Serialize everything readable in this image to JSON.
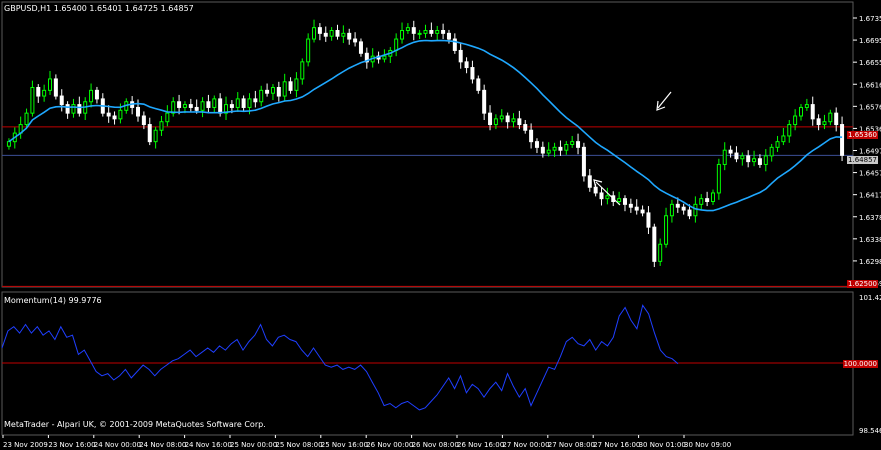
{
  "header": {
    "symbol_line": "GBPUSD,H1  1.65400 1.65401 1.64725 1.64857",
    "indicator_line": "Momentum(14) 99.9776",
    "copyright": "MetaTrader - Alpari UK, © 2001-2009 MetaQuotes Software Corp."
  },
  "colors": {
    "background": "#000000",
    "bull": "#00ff00",
    "bear": "#ffffff",
    "ma": "#1fa8ff",
    "hline_red": "#c00000",
    "hline_blue": "#3c4f96",
    "momentum": "#1f3fff",
    "border": "#5a5a5a"
  },
  "price_axis": {
    "ticks": [
      "1.67350",
      "1.66950",
      "1.66550",
      "1.66160",
      "1.65760",
      "1.65360",
      "1.64970",
      "1.64570",
      "1.64170",
      "1.63780",
      "1.63380",
      "1.62980",
      "1.62590"
    ],
    "tags": [
      {
        "label": "1.65360",
        "bg": "#c00000",
        "fg": "#ffffff"
      },
      {
        "label": "1.64857",
        "bg": "#c8c8c8",
        "fg": "#000000"
      },
      {
        "label": "1.62500",
        "bg": "#c00000",
        "fg": "#ffffff"
      }
    ]
  },
  "momentum_axis": {
    "ticks": [
      "101.428",
      "98.5464"
    ],
    "tag": {
      "label": "100.0000",
      "bg": "#c00000",
      "fg": "#ffffff"
    }
  },
  "time_axis": {
    "labels": [
      "23 Nov 2009",
      "23 Nov 16:00",
      "24 Nov 00:00",
      "24 Nov 08:00",
      "24 Nov 16:00",
      "25 Nov 00:00",
      "25 Nov 08:00",
      "25 Nov 16:00",
      "26 Nov 00:00",
      "26 Nov 08:00",
      "26 Nov 16:00",
      "27 Nov 00:00",
      "27 Nov 08:00",
      "27 Nov 16:00",
      "30 Nov 01:00",
      "30 Nov 09:00"
    ]
  },
  "chart_data": [
    {
      "type": "candlestick",
      "title": "GBPUSD,H1",
      "ylim": [
        1.6255,
        1.6755
      ],
      "hlines": [
        1.6536,
        1.6486,
        1.6256
      ],
      "closes": [
        1.651,
        1.6525,
        1.654,
        1.656,
        1.6605,
        1.659,
        1.66,
        1.662,
        1.659,
        1.6575,
        1.656,
        1.6575,
        1.656,
        1.658,
        1.66,
        1.6585,
        1.656,
        1.6555,
        1.655,
        1.6565,
        1.658,
        1.657,
        1.6555,
        1.654,
        1.651,
        1.653,
        1.6545,
        1.656,
        1.658,
        1.657,
        1.6575,
        1.657,
        1.6565,
        1.658,
        1.657,
        1.6585,
        1.656,
        1.6575,
        1.657,
        1.6585,
        1.657,
        1.6585,
        1.658,
        1.66,
        1.6595,
        1.6605,
        1.659,
        1.6615,
        1.66,
        1.662,
        1.665,
        1.669,
        1.671,
        1.67,
        1.6695,
        1.6705,
        1.6695,
        1.67,
        1.669,
        1.6685,
        1.6665,
        1.665,
        1.666,
        1.6655,
        1.666,
        1.667,
        1.669,
        1.6705,
        1.671,
        1.67,
        1.67,
        1.6705,
        1.67,
        1.6705,
        1.67,
        1.669,
        1.667,
        1.665,
        1.664,
        1.662,
        1.66,
        1.656,
        1.654,
        1.655,
        1.6555,
        1.6545,
        1.655,
        1.654,
        1.653,
        1.651,
        1.65,
        1.649,
        1.6495,
        1.65,
        1.6495,
        1.6505,
        1.651,
        1.65,
        1.645,
        1.643,
        1.642,
        1.641,
        1.6415,
        1.6405,
        1.641,
        1.64,
        1.6395,
        1.639,
        1.6385,
        1.636,
        1.63,
        1.633,
        1.638,
        1.64,
        1.6395,
        1.639,
        1.638,
        1.64,
        1.641,
        1.6405,
        1.642,
        1.647,
        1.6495,
        1.649,
        1.648,
        1.6485,
        1.6475,
        1.648,
        1.647,
        1.6485,
        1.65,
        1.651,
        1.652,
        1.654,
        1.6555,
        1.657,
        1.6575,
        1.655,
        1.654,
        1.6545,
        1.656,
        1.654,
        1.6486
      ]
    },
    {
      "type": "line",
      "title": "Momentum(14)",
      "ylim": [
        98.5464,
        101.428
      ],
      "hlines": [
        100.0
      ],
      "values": [
        100.35,
        100.75,
        100.85,
        100.7,
        100.9,
        100.7,
        100.85,
        100.65,
        100.75,
        100.55,
        100.85,
        100.6,
        100.65,
        100.2,
        100.3,
        100.05,
        99.8,
        99.7,
        99.75,
        99.6,
        99.7,
        99.85,
        99.65,
        99.8,
        99.95,
        99.85,
        99.7,
        99.85,
        99.95,
        100.05,
        100.1,
        100.2,
        100.3,
        100.15,
        100.25,
        100.35,
        100.25,
        100.4,
        100.3,
        100.45,
        100.55,
        100.3,
        100.5,
        100.65,
        100.9,
        100.55,
        100.4,
        100.6,
        100.65,
        100.55,
        100.5,
        100.3,
        100.15,
        100.35,
        100.15,
        99.95,
        99.9,
        99.95,
        99.85,
        99.9,
        99.85,
        99.95,
        99.8,
        99.55,
        99.3,
        99.0,
        99.05,
        98.95,
        99.05,
        99.1,
        99.0,
        98.9,
        98.95,
        99.1,
        99.25,
        99.45,
        99.65,
        99.4,
        99.7,
        99.3,
        99.5,
        99.4,
        99.2,
        99.4,
        99.55,
        99.35,
        99.75,
        99.45,
        99.2,
        99.4,
        99.0,
        99.3,
        99.6,
        99.9,
        99.85,
        100.15,
        100.5,
        100.6,
        100.45,
        100.4,
        100.55,
        100.3,
        100.5,
        100.4,
        100.6,
        101.1,
        101.3,
        101.0,
        100.8,
        101.35,
        101.15,
        100.7,
        100.3,
        100.15,
        100.1,
        99.98
      ]
    }
  ]
}
